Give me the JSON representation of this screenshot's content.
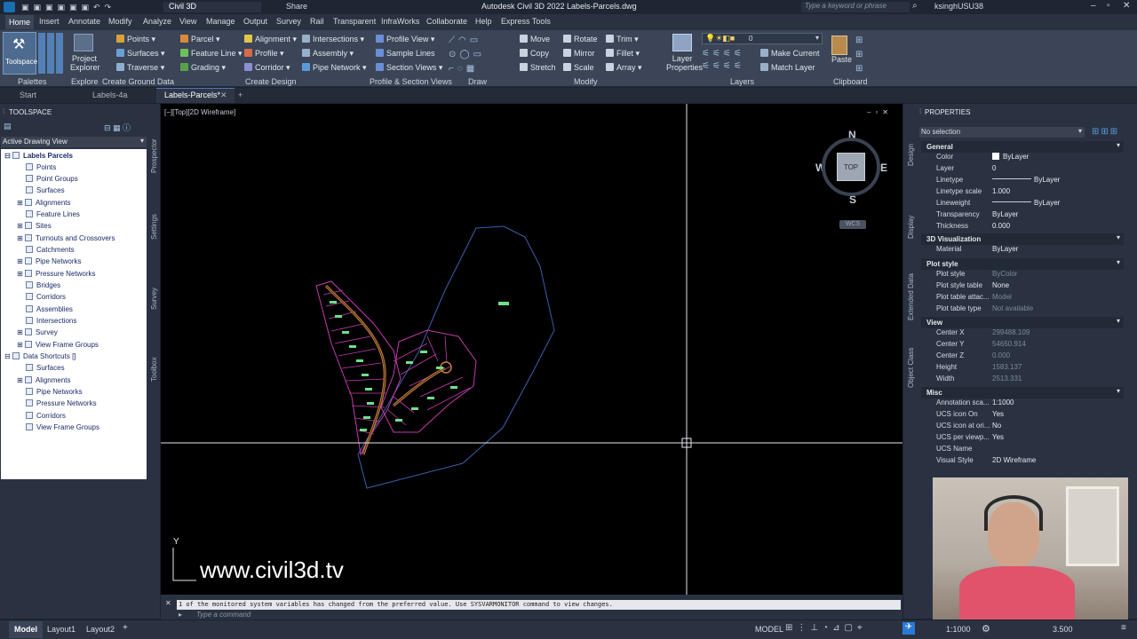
{
  "titlebar": {
    "workspace": "Civil 3D",
    "share": "Share",
    "title": "Autodesk Civil 3D 2022   Labels-Parcels.dwg",
    "search_placeholder": "Type a keyword or phrase",
    "user": "ksinghUSU38"
  },
  "menus": [
    "Home",
    "Insert",
    "Annotate",
    "Modify",
    "Analyze",
    "View",
    "Manage",
    "Output",
    "Survey",
    "Rail",
    "Transparent",
    "InfraWorks",
    "Collaborate",
    "Help",
    "Express Tools"
  ],
  "ribbon": {
    "palettes": {
      "toolspace": "Toolspace",
      "label": "Palettes"
    },
    "explore": {
      "project_explorer": "Project Explorer",
      "label": "Explore"
    },
    "ground": {
      "items": [
        "Points",
        "Surfaces",
        "Traverse"
      ],
      "label": "Create Ground Data"
    },
    "design": {
      "col1": [
        "Parcel",
        "Feature Line",
        "Grading"
      ],
      "col2": [
        "Alignment",
        "Profile",
        "Corridor"
      ],
      "col3": [
        "Intersections",
        "Assembly",
        "Pipe Network"
      ],
      "label": "Create Design"
    },
    "profile_section": {
      "items": [
        "Profile View",
        "Sample Lines",
        "Section Views"
      ],
      "label": "Profile & Section Views"
    },
    "draw": {
      "label": "Draw"
    },
    "modify": {
      "col1": [
        "Move",
        "Copy",
        "Stretch"
      ],
      "col2": [
        "Rotate",
        "Mirror",
        "Scale"
      ],
      "col3": [
        "Trim",
        "Fillet",
        "Array"
      ],
      "label": "Modify"
    },
    "layers": {
      "layer_properties": "Layer Properties",
      "current_layer": "0",
      "make_current": "Make Current",
      "match_layer": "Match Layer",
      "label": "Layers"
    },
    "clipboard": {
      "paste": "Paste",
      "label": "Clipboard"
    }
  },
  "doc_tabs": [
    "Start",
    "Labels-4a",
    "Labels-Parcels*"
  ],
  "toolspace": {
    "title": "TOOLSPACE",
    "view_select": "Active Drawing View",
    "root": "Labels Parcels",
    "items": [
      "Points",
      "Point Groups",
      "Surfaces",
      "Alignments",
      "Feature Lines",
      "Sites",
      "Turnouts and Crossovers",
      "Catchments",
      "Pipe Networks",
      "Pressure Networks",
      "Bridges",
      "Corridors",
      "Assemblies",
      "Intersections",
      "Survey",
      "View Frame Groups"
    ],
    "shortcuts_root": "Data Shortcuts []",
    "shortcuts": [
      "Surfaces",
      "Alignments",
      "Pipe Networks",
      "Pressure Networks",
      "Corridors",
      "View Frame Groups"
    ],
    "side_tabs": [
      "Prospector",
      "Settings",
      "Survey",
      "Toolbox"
    ]
  },
  "viewport": {
    "label": "[−][Top][2D Wireframe]",
    "compass": {
      "n": "N",
      "s": "S",
      "e": "E",
      "w": "W",
      "cube": "TOP",
      "wcs": "WCS"
    },
    "watermark": "www.civil3d.tv",
    "ucs_y": "Y"
  },
  "command": {
    "history": "1 of the monitored system variables has changed from the preferred value. Use SYSVARMONITOR command to view changes.",
    "placeholder": "Type a command"
  },
  "properties": {
    "title": "PROPERTIES",
    "selection": "No selection",
    "side_tabs": [
      "Design",
      "Display",
      "Extended Data",
      "Object Class"
    ],
    "sections": [
      {
        "name": "General",
        "rows": [
          [
            "Color",
            "ByLayer"
          ],
          [
            "Layer",
            "0"
          ],
          [
            "Linetype",
            "ByLayer"
          ],
          [
            "Linetype scale",
            "1.000"
          ],
          [
            "Lineweight",
            "ByLayer"
          ],
          [
            "Transparency",
            "ByLayer"
          ],
          [
            "Thickness",
            "0.000"
          ]
        ]
      },
      {
        "name": "3D Visualization",
        "rows": [
          [
            "Material",
            "ByLayer"
          ]
        ]
      },
      {
        "name": "Plot style",
        "rows": [
          [
            "Plot style",
            "ByColor"
          ],
          [
            "Plot style table",
            "None"
          ],
          [
            "Plot table attac...",
            "Model"
          ],
          [
            "Plot table type",
            "Not available"
          ]
        ]
      },
      {
        "name": "View",
        "rows": [
          [
            "Center X",
            "299488.109"
          ],
          [
            "Center Y",
            "54650.914"
          ],
          [
            "Center Z",
            "0.000"
          ],
          [
            "Height",
            "1583.137"
          ],
          [
            "Width",
            "2513.331"
          ]
        ]
      },
      {
        "name": "Misc",
        "rows": [
          [
            "Annotation sca...",
            "1:1000"
          ],
          [
            "UCS icon On",
            "Yes"
          ],
          [
            "UCS icon at ori...",
            "No"
          ],
          [
            "UCS per viewp...",
            "Yes"
          ],
          [
            "UCS Name",
            ""
          ],
          [
            "Visual Style",
            "2D Wireframe"
          ]
        ]
      }
    ]
  },
  "status": {
    "tabs": [
      "Model",
      "Layout1",
      "Layout2"
    ],
    "model": "MODEL",
    "scale": "1:1000",
    "value": "3.500"
  },
  "colors": {
    "accent": "#2b7bd6",
    "parcel": "#c43cae",
    "road": "#c87f3a",
    "boundary": "#3c5fae"
  }
}
